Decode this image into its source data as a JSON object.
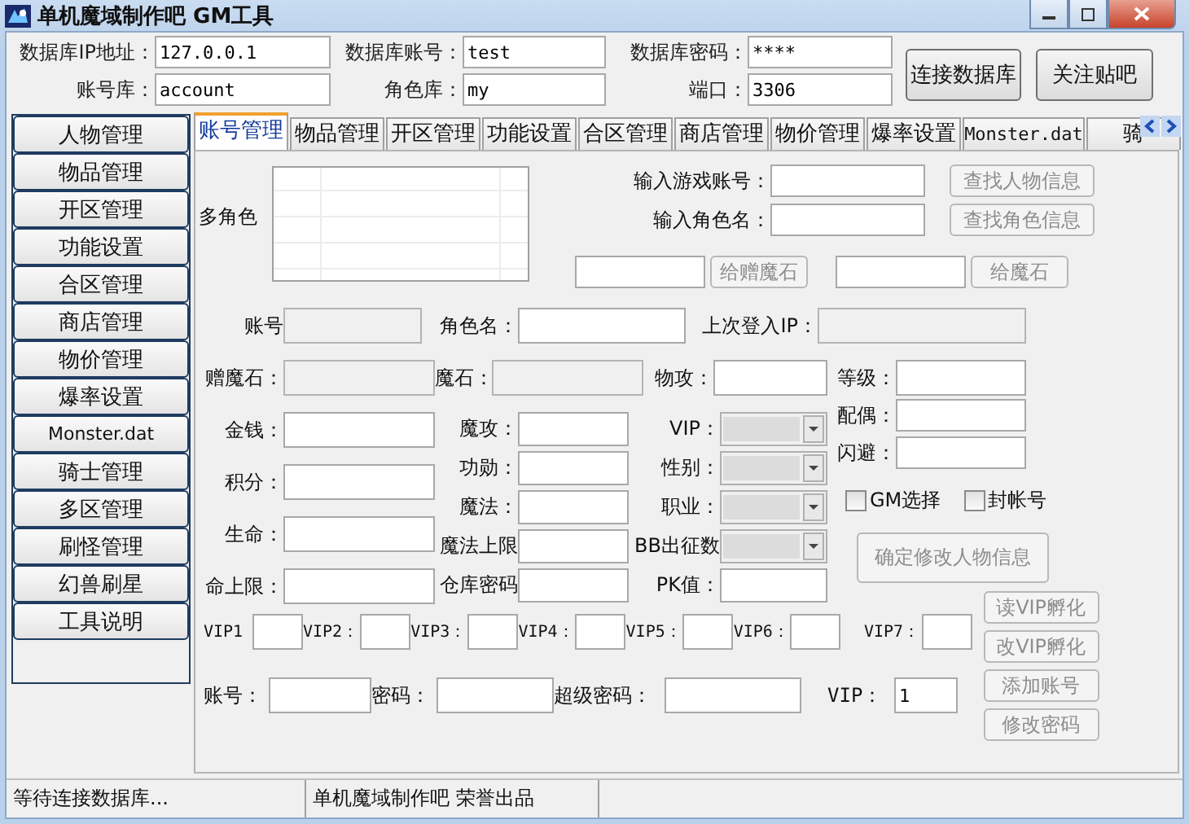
{
  "window": {
    "title": "单机魔域制作吧 GM工具"
  },
  "connection": {
    "fields": [
      {
        "label": "数据库IP地址：",
        "value": "127.0.0.1"
      },
      {
        "label": "数据库账号：",
        "value": "test"
      },
      {
        "label": "数据库密码：",
        "value": "****"
      },
      {
        "label": "账号库：",
        "value": "account"
      },
      {
        "label": "角色库：",
        "value": "my"
      },
      {
        "label": "端口：",
        "value": "3306"
      }
    ],
    "buttons": [
      "连接数据库",
      "关注贴吧"
    ]
  },
  "sidebar": {
    "items": [
      "人物管理",
      "物品管理",
      "开区管理",
      "功能设置",
      "合区管理",
      "商店管理",
      "物价管理",
      "爆率设置",
      "Monster.dat",
      "骑士管理",
      "多区管理",
      "刷怪管理",
      "幻兽刷星",
      "工具说明"
    ]
  },
  "tabs": [
    {
      "label": "账号管理",
      "selected": true
    },
    {
      "label": "物品管理",
      "selected": false
    },
    {
      "label": "开区管理",
      "selected": false
    },
    {
      "label": "功能设置",
      "selected": false
    },
    {
      "label": "合区管理",
      "selected": false
    },
    {
      "label": "商店管理",
      "selected": false
    },
    {
      "label": "物价管理",
      "selected": false
    },
    {
      "label": "爆率设置",
      "selected": false
    },
    {
      "label": "Monster.dat",
      "selected": false
    },
    {
      "label": "骑",
      "selected": false
    }
  ],
  "character_panel": {
    "list_label": "多角色",
    "lookups": [
      {
        "label": "输入游戏账号：",
        "button": "查找人物信息",
        "disabled": true
      },
      {
        "label": "输入角色名：",
        "button": "查找角色信息",
        "disabled": true
      }
    ],
    "gifts": [
      {
        "button": "给赠魔石",
        "disabled": true
      },
      {
        "button": "给魔石",
        "disabled": true
      }
    ],
    "info_row": [
      {
        "label": "账号",
        "disabled": true
      },
      {
        "label": "角色名：",
        "disabled": false
      },
      {
        "label": "上次登入IP：",
        "disabled": true
      }
    ],
    "stats_row": [
      {
        "label": "赠魔石：",
        "disabled": true
      },
      {
        "label": "魔石：",
        "disabled": true
      },
      {
        "label": "物攻：",
        "disabled": false
      },
      {
        "label": "等级：",
        "disabled": false
      }
    ],
    "columns": [
      [
        {
          "label": "金钱：",
          "kind": "text"
        },
        {
          "label": "积分：",
          "kind": "text"
        },
        {
          "label": "生命：",
          "kind": "text"
        },
        {
          "label": "命上限：",
          "kind": "text"
        }
      ],
      [
        {
          "label": "魔攻：",
          "kind": "text"
        },
        {
          "label": "功勋：",
          "kind": "text"
        },
        {
          "label": "魔法：",
          "kind": "text"
        },
        {
          "label": "魔法上限",
          "kind": "text"
        },
        {
          "label": "仓库密码",
          "kind": "text"
        }
      ],
      [
        {
          "label": "VIP：",
          "kind": "combo"
        },
        {
          "label": "性别：",
          "kind": "combo"
        },
        {
          "label": "职业：",
          "kind": "combo"
        },
        {
          "label": "BB出征数",
          "kind": "combo"
        },
        {
          "label": "PK值：",
          "kind": "text"
        }
      ],
      [
        {
          "label": "配偶：",
          "kind": "text"
        },
        {
          "label": "闪避：",
          "kind": "text"
        }
      ]
    ],
    "checkboxes": [
      {
        "label": "GM选择",
        "checked": false
      },
      {
        "label": "封帐号",
        "checked": false
      }
    ],
    "save_button": {
      "label": "确定修改人物信息",
      "disabled": true
    },
    "vip_fields": [
      {
        "label": "VIP1"
      },
      {
        "label": "VIP2："
      },
      {
        "label": "VIP3："
      },
      {
        "label": "VIP4："
      },
      {
        "label": "VIP5："
      },
      {
        "label": "VIP6："
      },
      {
        "label": "VIP7："
      }
    ],
    "account_row": [
      {
        "label": "账号："
      },
      {
        "label": "密码："
      },
      {
        "label": "超级密码："
      },
      {
        "label": "VIP：",
        "value": "1"
      }
    ],
    "side_buttons": [
      {
        "label": "读VIP孵化",
        "disabled": true
      },
      {
        "label": "改VIP孵化",
        "disabled": true
      },
      {
        "label": "添加账号",
        "disabled": true
      },
      {
        "label": "修改密码",
        "disabled": true
      }
    ]
  },
  "status_bar": [
    "等待连接数据库...",
    "单机魔域制作吧 荣誉出品"
  ]
}
